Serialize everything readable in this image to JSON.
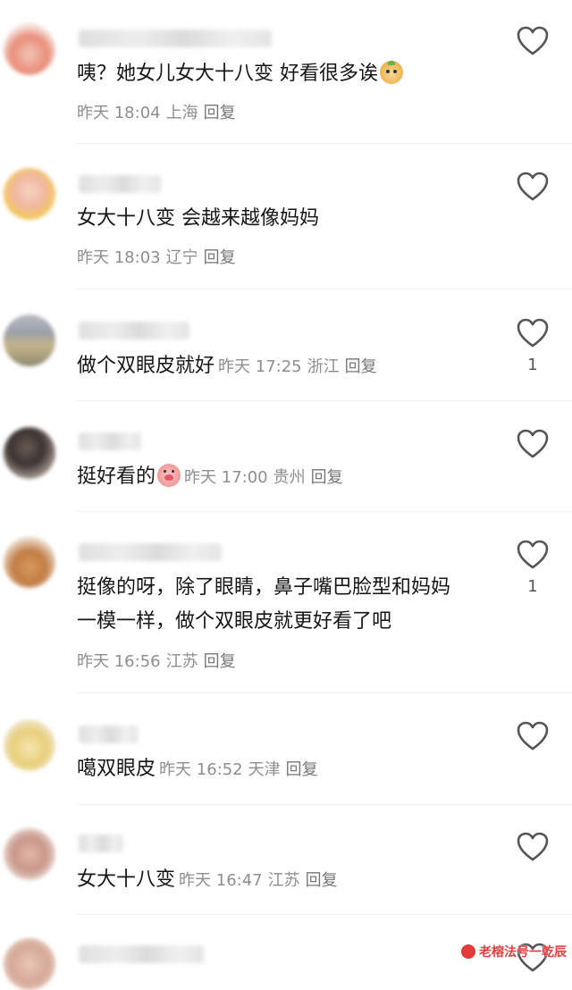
{
  "comments": [
    {
      "text": "咦？她女儿女大十八变 好看很多诶",
      "emoji": "monkey-emoji",
      "time": "昨天 18:04",
      "location": "上海",
      "reply": "回复",
      "likes": ""
    },
    {
      "text": "女大十八变 会越来越像妈妈",
      "time": "昨天 18:03",
      "location": "辽宁",
      "reply": "回复",
      "likes": ""
    },
    {
      "text": "做个双眼皮就好",
      "time": "昨天 17:25",
      "location": "浙江",
      "reply": "回复",
      "likes": "1"
    },
    {
      "text": "挺好看的",
      "emoji": "pig-emoji",
      "time": "昨天 17:00",
      "location": "贵州",
      "reply": "回复",
      "likes": ""
    },
    {
      "text_line1": "挺像的呀，除了眼睛，鼻子嘴巴脸型和妈妈",
      "text_line2": "一模一样，做个双眼皮就更好看了吧",
      "time": "昨天 16:56",
      "location": "江苏",
      "reply": "回复",
      "likes": "1"
    },
    {
      "text": "噶双眼皮",
      "time": "昨天 16:52",
      "location": "天津",
      "reply": "回复",
      "likes": ""
    },
    {
      "text": "女大十八变",
      "time": "昨天 16:47",
      "location": "江苏",
      "reply": "回复",
      "likes": ""
    }
  ],
  "watermark": "老榕法号一乾辰",
  "icons": {
    "like": "heart-outline-icon"
  },
  "colors": {
    "text": "#161616",
    "meta": "#8e8e8e",
    "heart": "#555555",
    "watermark": "#e04040"
  }
}
